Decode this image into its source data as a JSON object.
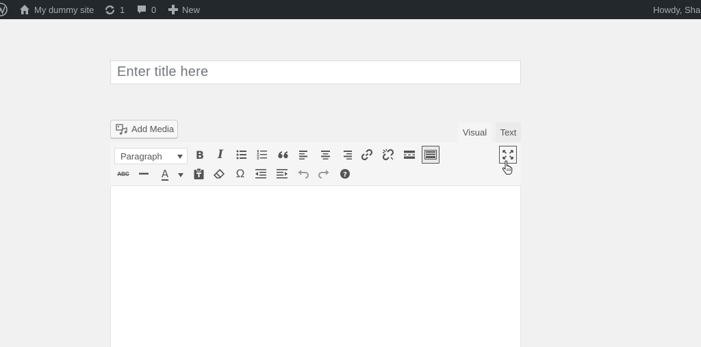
{
  "adminbar": {
    "site_name": "My dummy site",
    "updates_count": "1",
    "comments_count": "0",
    "new_label": "New",
    "howdy": "Howdy, Sha"
  },
  "title_field": {
    "placeholder": "Enter title here"
  },
  "media": {
    "add_media_label": "Add Media"
  },
  "tabs": {
    "visual": "Visual",
    "text": "Text"
  },
  "toolbar": {
    "format_select_value": "Paragraph",
    "bold_glyph": "B",
    "italic_glyph": "I",
    "blockquote_glyph": "“",
    "strikethrough_glyph": "ABC",
    "textcolor_glyph": "A",
    "special_char_glyph": "Ω",
    "help_glyph": "?"
  },
  "colors": {
    "adminbar_bg": "#23282d",
    "page_bg": "#f1f1f1",
    "toolbar_bg": "#f5f5f5"
  }
}
